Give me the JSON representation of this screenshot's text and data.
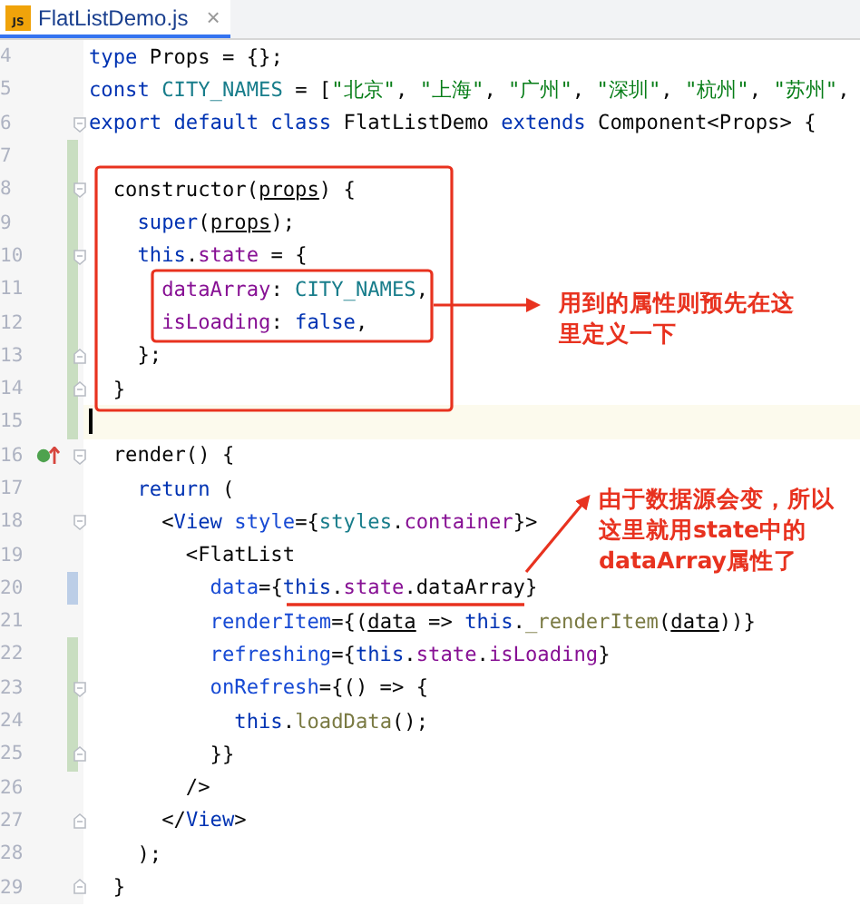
{
  "tab": {
    "label": "FlatListDemo.js",
    "close": "×",
    "selected": true,
    "icon_label": "JS"
  },
  "lines": [
    {
      "number": "4",
      "added": false,
      "modified": false,
      "fold_start": false,
      "fold_end": false,
      "current": false,
      "override": false,
      "segments": [
        {
          "kind": "keyword",
          "text": "type"
        },
        {
          "kind": "plain",
          "text": " Props = {};"
        }
      ]
    },
    {
      "number": "5",
      "added": false,
      "modified": false,
      "fold_start": false,
      "fold_end": false,
      "current": false,
      "override": false,
      "segments": [
        {
          "kind": "keyword",
          "text": "const"
        },
        {
          "kind": "constant",
          "text": " CITY_NAMES"
        },
        {
          "kind": "plain",
          "text": " = ["
        },
        {
          "kind": "string",
          "text": "\"北京\""
        },
        {
          "kind": "plain",
          "text": ", "
        },
        {
          "kind": "string",
          "text": "\"上海\""
        },
        {
          "kind": "plain",
          "text": ", "
        },
        {
          "kind": "string",
          "text": "\"广州\""
        },
        {
          "kind": "plain",
          "text": ", "
        },
        {
          "kind": "string",
          "text": "\"深圳\""
        },
        {
          "kind": "plain",
          "text": ", "
        },
        {
          "kind": "string",
          "text": "\"杭州\""
        },
        {
          "kind": "plain",
          "text": ", "
        },
        {
          "kind": "string",
          "text": "\"苏州\""
        },
        {
          "kind": "plain",
          "text": ","
        }
      ]
    },
    {
      "number": "6",
      "added": false,
      "modified": false,
      "fold_start": true,
      "fold_end": false,
      "current": false,
      "override": false,
      "segments": [
        {
          "kind": "keyword",
          "text": "export default class"
        },
        {
          "kind": "plain",
          "text": " FlatListDemo "
        },
        {
          "kind": "keyword",
          "text": "extends"
        },
        {
          "kind": "plain",
          "text": " Component<Props> {"
        }
      ]
    },
    {
      "number": "7",
      "added": true,
      "modified": false,
      "fold_start": false,
      "fold_end": false,
      "current": false,
      "override": false
    },
    {
      "number": "8",
      "added": true,
      "modified": false,
      "fold_start": true,
      "fold_end": false,
      "current": false,
      "override": false,
      "segments": [
        {
          "kind": "plain",
          "text": "  constructor("
        },
        {
          "kind": "param",
          "text": "props"
        },
        {
          "kind": "plain",
          "text": ") {"
        }
      ]
    },
    {
      "number": "9",
      "added": true,
      "modified": false,
      "fold_start": false,
      "fold_end": false,
      "current": false,
      "override": false,
      "segments": [
        {
          "kind": "keyword",
          "text": "    super"
        },
        {
          "kind": "plain",
          "text": "("
        },
        {
          "kind": "param",
          "text": "props"
        },
        {
          "kind": "plain",
          "text": ");"
        }
      ]
    },
    {
      "number": "10",
      "added": true,
      "modified": false,
      "fold_start": true,
      "fold_end": false,
      "current": false,
      "override": false,
      "segments": [
        {
          "kind": "keyword",
          "text": "    this"
        },
        {
          "kind": "plain",
          "text": "."
        },
        {
          "kind": "field",
          "text": "state"
        },
        {
          "kind": "plain",
          "text": " = {"
        }
      ]
    },
    {
      "number": "11",
      "added": true,
      "modified": false,
      "fold_start": false,
      "fold_end": false,
      "current": false,
      "override": false,
      "segments": [
        {
          "kind": "field",
          "text": "      dataArray"
        },
        {
          "kind": "plain",
          "text": ": "
        },
        {
          "kind": "constant",
          "text": "CITY_NAMES"
        },
        {
          "kind": "plain",
          "text": ","
        }
      ]
    },
    {
      "number": "12",
      "added": true,
      "modified": false,
      "fold_start": false,
      "fold_end": false,
      "current": false,
      "override": false,
      "segments": [
        {
          "kind": "field",
          "text": "      isLoading"
        },
        {
          "kind": "plain",
          "text": ": "
        },
        {
          "kind": "keyword",
          "text": "false"
        },
        {
          "kind": "plain",
          "text": ","
        }
      ]
    },
    {
      "number": "13",
      "added": true,
      "modified": false,
      "fold_start": false,
      "fold_end": true,
      "current": false,
      "override": false,
      "segments": [
        {
          "kind": "plain",
          "text": "    };"
        }
      ]
    },
    {
      "number": "14",
      "added": true,
      "modified": false,
      "fold_start": false,
      "fold_end": true,
      "current": false,
      "override": false,
      "segments": [
        {
          "kind": "plain",
          "text": "  }"
        }
      ]
    },
    {
      "number": "15",
      "added": true,
      "modified": false,
      "fold_start": false,
      "fold_end": false,
      "current": true,
      "override": false
    },
    {
      "number": "16",
      "added": false,
      "modified": false,
      "fold_start": true,
      "fold_end": false,
      "current": false,
      "override": true,
      "segments": [
        {
          "kind": "plain",
          "text": "  render() {"
        }
      ]
    },
    {
      "number": "17",
      "added": false,
      "modified": false,
      "fold_start": false,
      "fold_end": false,
      "current": false,
      "override": false,
      "segments": [
        {
          "kind": "keyword",
          "text": "    return"
        },
        {
          "kind": "plain",
          "text": " ("
        }
      ]
    },
    {
      "number": "18",
      "added": false,
      "modified": false,
      "fold_start": true,
      "fold_end": false,
      "current": false,
      "override": false,
      "segments": [
        {
          "kind": "plain",
          "text": "      <"
        },
        {
          "kind": "tag",
          "text": "View"
        },
        {
          "kind": "attribute",
          "text": " style"
        },
        {
          "kind": "plain",
          "text": "={"
        },
        {
          "kind": "constant",
          "text": "styles"
        },
        {
          "kind": "plain",
          "text": "."
        },
        {
          "kind": "field",
          "text": "container"
        },
        {
          "kind": "plain",
          "text": "}>"
        }
      ]
    },
    {
      "number": "19",
      "added": false,
      "modified": false,
      "fold_start": false,
      "fold_end": false,
      "current": false,
      "override": false,
      "segments": [
        {
          "kind": "plain",
          "text": "        <FlatList"
        }
      ]
    },
    {
      "number": "20",
      "added": false,
      "modified": true,
      "fold_start": false,
      "fold_end": false,
      "current": false,
      "override": false,
      "segments": [
        {
          "kind": "attribute",
          "text": "          data"
        },
        {
          "kind": "plain",
          "text": "={"
        },
        {
          "kind": "keyword",
          "text": "this"
        },
        {
          "kind": "plain",
          "text": "."
        },
        {
          "kind": "field",
          "text": "state"
        },
        {
          "kind": "plain",
          "text": ".dataArray}"
        }
      ]
    },
    {
      "number": "21",
      "added": false,
      "modified": false,
      "fold_start": false,
      "fold_end": false,
      "current": false,
      "override": false,
      "segments": [
        {
          "kind": "attribute",
          "text": "          renderItem"
        },
        {
          "kind": "plain",
          "text": "={("
        },
        {
          "kind": "param",
          "text": "data"
        },
        {
          "kind": "plain",
          "text": " => "
        },
        {
          "kind": "keyword",
          "text": "this"
        },
        {
          "kind": "plain",
          "text": "."
        },
        {
          "kind": "method",
          "text": "_renderItem"
        },
        {
          "kind": "plain",
          "text": "("
        },
        {
          "kind": "param",
          "text": "data"
        },
        {
          "kind": "plain",
          "text": "))}"
        }
      ]
    },
    {
      "number": "22",
      "added": true,
      "modified": false,
      "fold_start": false,
      "fold_end": false,
      "current": false,
      "override": false,
      "segments": [
        {
          "kind": "attribute",
          "text": "          refreshing"
        },
        {
          "kind": "plain",
          "text": "={"
        },
        {
          "kind": "keyword",
          "text": "this"
        },
        {
          "kind": "plain",
          "text": "."
        },
        {
          "kind": "field",
          "text": "state"
        },
        {
          "kind": "plain",
          "text": "."
        },
        {
          "kind": "field",
          "text": "isLoading"
        },
        {
          "kind": "plain",
          "text": "}"
        }
      ]
    },
    {
      "number": "23",
      "added": true,
      "modified": false,
      "fold_start": true,
      "fold_end": false,
      "current": false,
      "override": false,
      "segments": [
        {
          "kind": "attribute",
          "text": "          onRefresh"
        },
        {
          "kind": "plain",
          "text": "={() => {"
        }
      ]
    },
    {
      "number": "24",
      "added": true,
      "modified": false,
      "fold_start": false,
      "fold_end": false,
      "current": false,
      "override": false,
      "segments": [
        {
          "kind": "keyword",
          "text": "            this"
        },
        {
          "kind": "plain",
          "text": "."
        },
        {
          "kind": "method",
          "text": "loadData"
        },
        {
          "kind": "plain",
          "text": "();"
        }
      ]
    },
    {
      "number": "25",
      "added": true,
      "modified": false,
      "fold_start": false,
      "fold_end": true,
      "current": false,
      "override": false,
      "segments": [
        {
          "kind": "plain",
          "text": "          }}"
        }
      ]
    },
    {
      "number": "26",
      "added": false,
      "modified": false,
      "fold_start": false,
      "fold_end": false,
      "current": false,
      "override": false,
      "segments": [
        {
          "kind": "plain",
          "text": "        />"
        }
      ]
    },
    {
      "number": "27",
      "added": false,
      "modified": false,
      "fold_start": false,
      "fold_end": true,
      "current": false,
      "override": false,
      "segments": [
        {
          "kind": "plain",
          "text": "      </"
        },
        {
          "kind": "tag",
          "text": "View"
        },
        {
          "kind": "plain",
          "text": ">"
        }
      ]
    },
    {
      "number": "28",
      "added": false,
      "modified": false,
      "fold_start": false,
      "fold_end": false,
      "current": false,
      "override": false,
      "segments": [
        {
          "kind": "plain",
          "text": "    );"
        }
      ]
    },
    {
      "number": "29",
      "added": false,
      "modified": false,
      "fold_start": false,
      "fold_end": true,
      "current": false,
      "override": false,
      "segments": [
        {
          "kind": "plain",
          "text": "  }"
        }
      ]
    }
  ],
  "callouts": [
    {
      "text": "用到的属性则预先在这里定义一下"
    },
    {
      "text": "由于数据源会变，所以这里就用state中的dataArray属性了"
    }
  ]
}
